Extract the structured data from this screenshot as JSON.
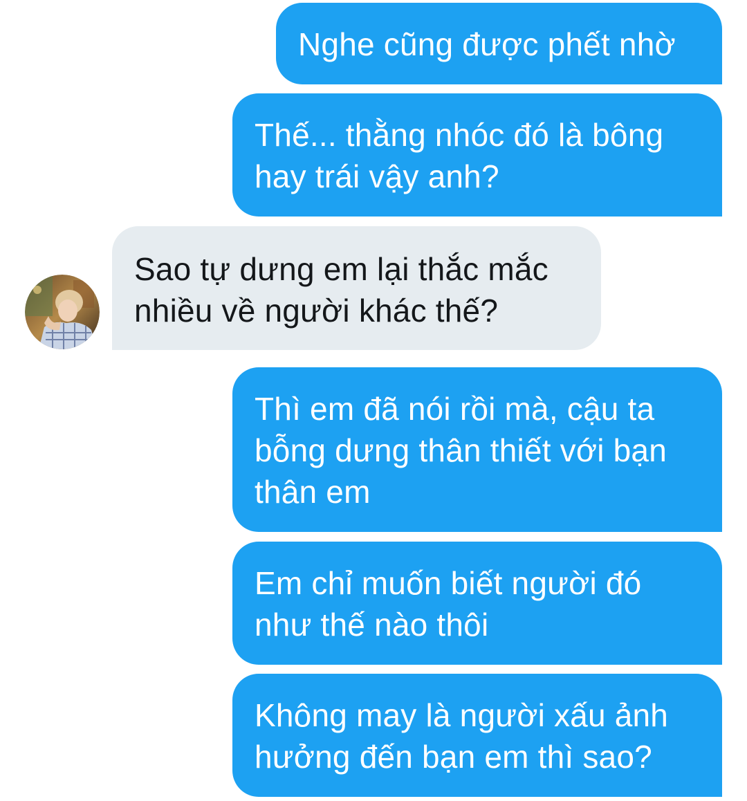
{
  "messages": [
    {
      "direction": "outgoing",
      "lines": [
        "Nghe cũng được phết nhờ"
      ]
    },
    {
      "direction": "outgoing",
      "lines": [
        "Thế... thằng nhóc đó là bông",
        "hay trái vậy anh?"
      ]
    },
    {
      "direction": "incoming",
      "lines": [
        "Sao tự dưng em lại thắc mắc",
        "nhiều về người khác thế?"
      ]
    },
    {
      "direction": "outgoing",
      "lines": [
        "Thì em đã nói rồi mà, cậu ta",
        "bỗng dưng thân thiết với bạn",
        "thân em"
      ]
    },
    {
      "direction": "outgoing",
      "lines": [
        "Em chỉ muốn biết người đó",
        "như thế nào thôi"
      ]
    },
    {
      "direction": "outgoing",
      "lines": [
        "Không may là người xấu ảnh",
        "hưởng đến bạn em thì sao?"
      ]
    }
  ],
  "colors": {
    "outgoing_bubble": "#1da1f2",
    "incoming_bubble": "#e6ecf0",
    "outgoing_text": "#ffffff",
    "incoming_text": "#14171a"
  },
  "avatar": {
    "icon": "user-avatar-photo"
  }
}
